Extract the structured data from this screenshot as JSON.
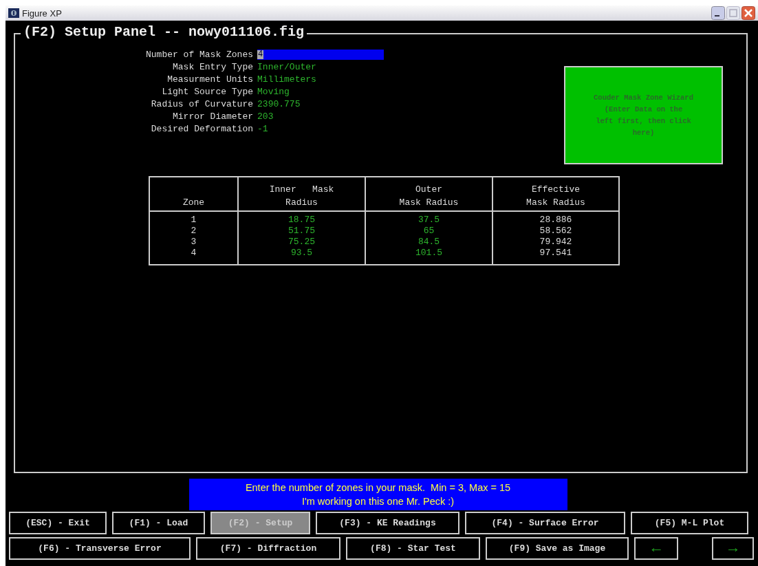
{
  "window": {
    "title": "Figure XP"
  },
  "panel": {
    "title": "(F2) Setup Panel -- nowy011106.fig"
  },
  "fields": [
    {
      "label": "Number of Mask Zones",
      "value": "4",
      "kind": "input",
      "focused": true
    },
    {
      "label": "Mask Entry Type",
      "value": "Inner/Outer",
      "kind": "text"
    },
    {
      "label": "Measurment Units",
      "value": "Millimeters",
      "kind": "text"
    },
    {
      "label": "Light Source Type",
      "value": "Moving",
      "kind": "text"
    },
    {
      "label": "Radius of Curvature",
      "value": "2390.775",
      "kind": "text"
    },
    {
      "label": "Mirror Diameter",
      "value": "203",
      "kind": "text"
    },
    {
      "label": "Desired Deformation",
      "value": "-1",
      "kind": "text"
    }
  ],
  "wizard_button": {
    "lines": [
      "Couder Mask Zone Wizard",
      "(Enter Data on the",
      "left first, then click",
      "here)"
    ]
  },
  "table": {
    "columns": [
      {
        "heading_lines": [
          "Zone"
        ],
        "kind": "index"
      },
      {
        "heading_lines": [
          "Inner   Mask",
          "Radius"
        ],
        "kind": "input"
      },
      {
        "heading_lines": [
          "Outer",
          "Mask Radius"
        ],
        "kind": "input"
      },
      {
        "heading_lines": [
          "Effective",
          "Mask Radius"
        ],
        "kind": "computed"
      }
    ],
    "rows": [
      [
        "1",
        "18.75",
        "37.5",
        "28.886"
      ],
      [
        "2",
        "51.75",
        "65",
        "58.562"
      ],
      [
        "3",
        "75.25",
        "84.5",
        "79.942"
      ],
      [
        "4",
        "93.5",
        "101.5",
        "97.541"
      ]
    ]
  },
  "message": {
    "lines": [
      "Enter the number of zones in your mask.  Min = 3, Max = 15",
      "I'm working on this one Mr. Peck :)"
    ]
  },
  "button_rows": [
    [
      {
        "label": "(ESC) - Exit",
        "selected": false,
        "kind": "text"
      },
      {
        "label": "(F1) - Load",
        "selected": false,
        "kind": "text"
      },
      {
        "label": "(F2) - Setup",
        "selected": true,
        "kind": "text"
      },
      {
        "label": "(F3) - KE Readings",
        "selected": false,
        "kind": "text"
      },
      {
        "label": "(F4) - Surface Error",
        "selected": false,
        "kind": "text"
      },
      {
        "label": "(F5) M-L Plot",
        "selected": false,
        "kind": "text"
      }
    ],
    [
      {
        "label": "(F6) - Transverse Error",
        "selected": false,
        "kind": "text"
      },
      {
        "label": "(F7) - Diffraction",
        "selected": false,
        "kind": "text"
      },
      {
        "label": "(F8) - Star Test",
        "selected": false,
        "kind": "text"
      },
      {
        "label": "(F9) Save as Image",
        "selected": false,
        "kind": "text"
      },
      {
        "label": "←",
        "selected": false,
        "kind": "arrow"
      },
      {
        "label": "→",
        "selected": false,
        "kind": "arrow"
      }
    ]
  ]
}
